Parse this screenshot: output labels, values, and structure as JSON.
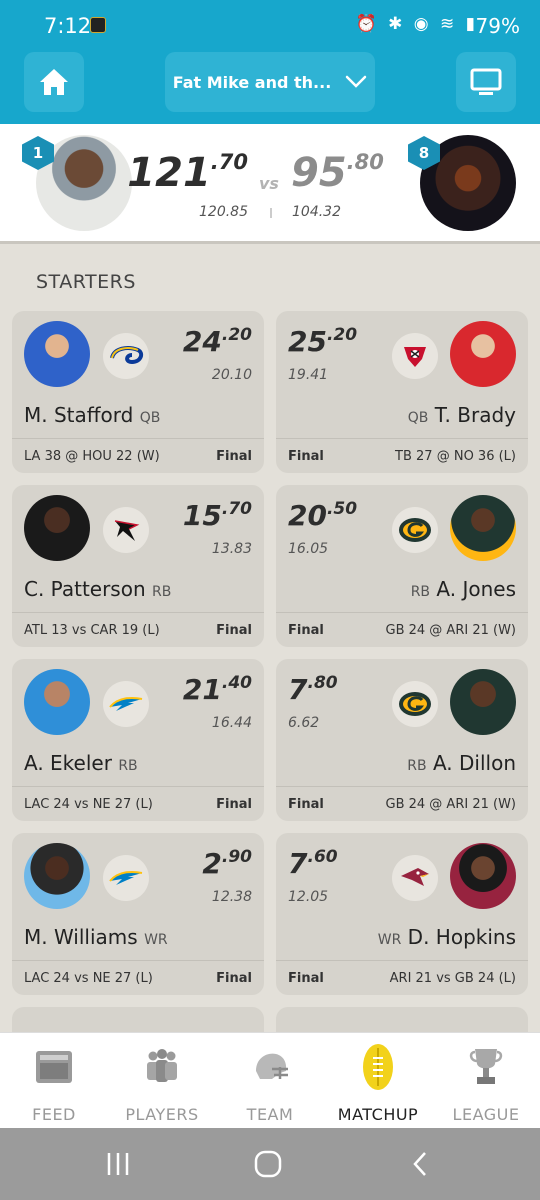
{
  "status_bar": {
    "time": "7:12",
    "battery": "79%"
  },
  "header": {
    "team_select_label": "Fat Mike and th..."
  },
  "matchup": {
    "left": {
      "rank": "1",
      "score_int": "121",
      "score_dec": ".70",
      "projected": "120.85"
    },
    "vs": "vs",
    "right": {
      "rank": "8",
      "score_int": "95",
      "score_dec": ".80",
      "projected": "104.32"
    }
  },
  "section_title": "STARTERS",
  "rows": [
    {
      "left": {
        "points_int": "24",
        "points_dec": ".20",
        "projected": "20.10",
        "name": "M. Stafford",
        "position": "QB",
        "game": "LA 38 @ HOU 22 (W)",
        "status": "Final",
        "team_icon": "rams-logo-icon"
      },
      "right": {
        "points_int": "25",
        "points_dec": ".20",
        "projected": "19.41",
        "name": "T. Brady",
        "position": "QB",
        "game": "TB 27 @ NO 36 (L)",
        "status": "Final",
        "team_icon": "buccaneers-logo-icon"
      }
    },
    {
      "left": {
        "points_int": "15",
        "points_dec": ".70",
        "projected": "13.83",
        "name": "C. Patterson",
        "position": "RB",
        "game": "ATL 13 vs CAR 19 (L)",
        "status": "Final",
        "team_icon": "falcons-logo-icon"
      },
      "right": {
        "points_int": "20",
        "points_dec": ".50",
        "projected": "16.05",
        "name": "A. Jones",
        "position": "RB",
        "game": "GB 24 @ ARI 21 (W)",
        "status": "Final",
        "team_icon": "packers-logo-icon"
      }
    },
    {
      "left": {
        "points_int": "21",
        "points_dec": ".40",
        "projected": "16.44",
        "name": "A. Ekeler",
        "position": "RB",
        "game": "LAC 24 vs NE 27 (L)",
        "status": "Final",
        "team_icon": "chargers-logo-icon"
      },
      "right": {
        "points_int": "7",
        "points_dec": ".80",
        "projected": "6.62",
        "name": "A. Dillon",
        "position": "RB",
        "game": "GB 24 @ ARI 21 (W)",
        "status": "Final",
        "team_icon": "packers-logo-icon"
      }
    },
    {
      "left": {
        "points_int": "2",
        "points_dec": ".90",
        "projected": "12.38",
        "name": "M. Williams",
        "position": "WR",
        "game": "LAC 24 vs NE 27 (L)",
        "status": "Final",
        "team_icon": "chargers-logo-icon"
      },
      "right": {
        "points_int": "7",
        "points_dec": ".60",
        "projected": "12.05",
        "name": "D. Hopkins",
        "position": "WR",
        "game": "ARI 21 vs GB 24 (L)",
        "status": "Final",
        "team_icon": "cardinals-logo-icon"
      }
    }
  ],
  "bottom_nav": [
    {
      "label": "FEED",
      "icon": "feed-icon"
    },
    {
      "label": "PLAYERS",
      "icon": "players-icon"
    },
    {
      "label": "TEAM",
      "icon": "helmet-icon"
    },
    {
      "label": "MATCHUP",
      "icon": "football-icon",
      "active": true
    },
    {
      "label": "LEAGUE",
      "icon": "trophy-icon"
    }
  ],
  "colors": {
    "header": "#17a7cc",
    "badge": "#1a8fb5",
    "card": "#d6d3cc",
    "background": "#e3e0d9",
    "active_icon": "#f2d21b"
  }
}
